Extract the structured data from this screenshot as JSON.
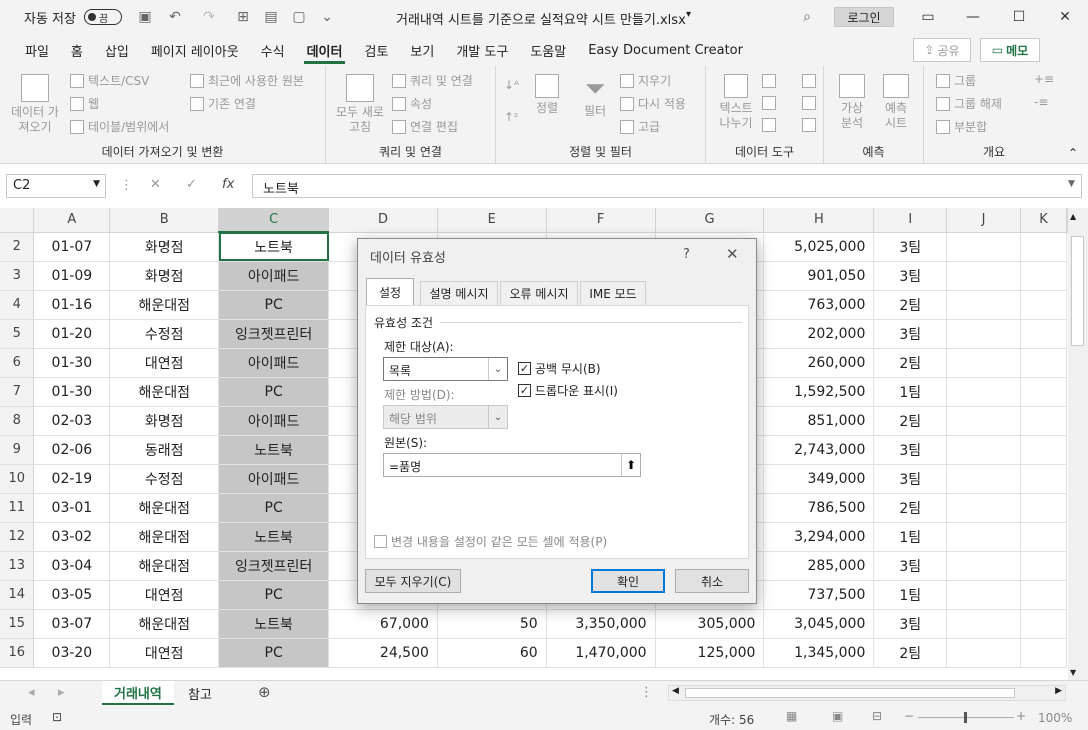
{
  "titlebar": {
    "autosave": "자동 저장",
    "toggle": "끔",
    "filename": "거래내역 시트를 기준으로 실적요약 시트 만들기.xlsx",
    "login": "로그인"
  },
  "menus": [
    "파일",
    "홈",
    "삽입",
    "페이지 레이아웃",
    "수식",
    "데이터",
    "검토",
    "보기",
    "개발 도구",
    "도움말",
    "Easy Document Creator"
  ],
  "active_menu": "데이터",
  "share": "공유",
  "memo": "메모",
  "ribbon": {
    "g1": {
      "label": "데이터 가져오기 및 변환",
      "big": "데이터 가\n져오기",
      "items": [
        "텍스트/CSV",
        "웹",
        "테이블/범위에서",
        "최근에 사용한 원본",
        "기존 연결"
      ]
    },
    "g2": {
      "label": "쿼리 및 연결",
      "big": "모두 새로\n고침",
      "items": [
        "쿼리 및 연결",
        "속성",
        "연결 편집"
      ]
    },
    "g3": {
      "label": "정렬 및 필터",
      "sort": "정렬",
      "filter": "필터",
      "items": [
        "지우기",
        "다시 적용",
        "고급"
      ]
    },
    "g4": {
      "label": "데이터 도구",
      "big": "텍스트\n나누기"
    },
    "g5": {
      "label": "예측",
      "items": [
        "가상\n분석",
        "예측\n시트"
      ]
    },
    "g6": {
      "label": "개요",
      "items": [
        "그룹",
        "그룹 해제",
        "부분합"
      ]
    }
  },
  "formula": {
    "namebox": "C2",
    "fx": "fx",
    "value": "노트북"
  },
  "columns": [
    "A",
    "B",
    "C",
    "D",
    "E",
    "F",
    "G",
    "H",
    "I",
    "J",
    "K"
  ],
  "rows": [
    {
      "n": "2",
      "a": "01-07",
      "b": "화명점",
      "c": "노트북",
      "d": "",
      "e": "",
      "f": "",
      "g": "",
      "h": "5,025,000",
      "i": "3팀"
    },
    {
      "n": "3",
      "a": "01-09",
      "b": "화명점",
      "c": "아이패드",
      "d": "",
      "e": "",
      "f": "",
      "g": "",
      "h": "901,050",
      "i": "3팀"
    },
    {
      "n": "4",
      "a": "01-16",
      "b": "해운대점",
      "c": "PC",
      "d": "",
      "e": "",
      "f": "",
      "g": "",
      "h": "763,000",
      "i": "2팀"
    },
    {
      "n": "5",
      "a": "01-20",
      "b": "수정점",
      "c": "잉크젯프린터",
      "d": "",
      "e": "",
      "f": "",
      "g": "",
      "h": "202,000",
      "i": "3팀"
    },
    {
      "n": "6",
      "a": "01-30",
      "b": "대연점",
      "c": "아이패드",
      "d": "",
      "e": "",
      "f": "",
      "g": "",
      "h": "260,000",
      "i": "2팀"
    },
    {
      "n": "7",
      "a": "01-30",
      "b": "해운대점",
      "c": "PC",
      "d": "",
      "e": "",
      "f": "",
      "g": "",
      "h": "1,592,500",
      "i": "1팀"
    },
    {
      "n": "8",
      "a": "02-03",
      "b": "화명점",
      "c": "아이패드",
      "d": "",
      "e": "",
      "f": "",
      "g": "",
      "h": "851,000",
      "i": "2팀"
    },
    {
      "n": "9",
      "a": "02-06",
      "b": "동래점",
      "c": "노트북",
      "d": "",
      "e": "",
      "f": "",
      "g": "",
      "h": "2,743,000",
      "i": "3팀"
    },
    {
      "n": "10",
      "a": "02-19",
      "b": "수정점",
      "c": "아이패드",
      "d": "",
      "e": "",
      "f": "",
      "g": "",
      "h": "349,000",
      "i": "3팀"
    },
    {
      "n": "11",
      "a": "03-01",
      "b": "해운대점",
      "c": "PC",
      "d": "",
      "e": "",
      "f": "",
      "g": "",
      "h": "786,500",
      "i": "2팀"
    },
    {
      "n": "12",
      "a": "03-02",
      "b": "해운대점",
      "c": "노트북",
      "d": "",
      "e": "",
      "f": "",
      "g": "",
      "h": "3,294,000",
      "i": "1팀"
    },
    {
      "n": "13",
      "a": "03-04",
      "b": "해운대점",
      "c": "잉크젯프린터",
      "d": "",
      "e": "",
      "f": "",
      "g": "",
      "h": "285,000",
      "i": "3팀"
    },
    {
      "n": "14",
      "a": "03-05",
      "b": "대연점",
      "c": "PC",
      "d": "",
      "e": "",
      "f": "",
      "g": "",
      "h": "737,500",
      "i": "1팀"
    },
    {
      "n": "15",
      "a": "03-07",
      "b": "해운대점",
      "c": "노트북",
      "d": "67,000",
      "e": "50",
      "f": "3,350,000",
      "g": "305,000",
      "h": "3,045,000",
      "i": "3팀"
    },
    {
      "n": "16",
      "a": "03-20",
      "b": "대연점",
      "c": "PC",
      "d": "24,500",
      "e": "60",
      "f": "1,470,000",
      "g": "125,000",
      "h": "1,345,000",
      "i": "2팀"
    }
  ],
  "sheets": [
    "거래내역",
    "참고"
  ],
  "status": {
    "mode": "입력",
    "count": "개수: 56",
    "zoom": "100%"
  },
  "dialog": {
    "title": "데이터 유효성",
    "help": "?",
    "tabs": [
      "설정",
      "설명 메시지",
      "오류 메시지",
      "IME 모드"
    ],
    "section": "유효성 조건",
    "allow_label": "제한 대상(A):",
    "allow_value": "목록",
    "ignore_blank": "공백 무시(B)",
    "dropdown": "드롭다운 표시(I)",
    "data_label": "제한 방법(D):",
    "data_value": "해당 범위",
    "source_label": "원본(S):",
    "source_value": "=품명",
    "apply_all": "변경 내용을 설정이 같은 모든 셀에 적용(P)",
    "clear_all": "모두 지우기(C)",
    "ok": "확인",
    "cancel": "취소"
  },
  "colors": {
    "accent": "#217346",
    "focus": "#0078d7"
  }
}
